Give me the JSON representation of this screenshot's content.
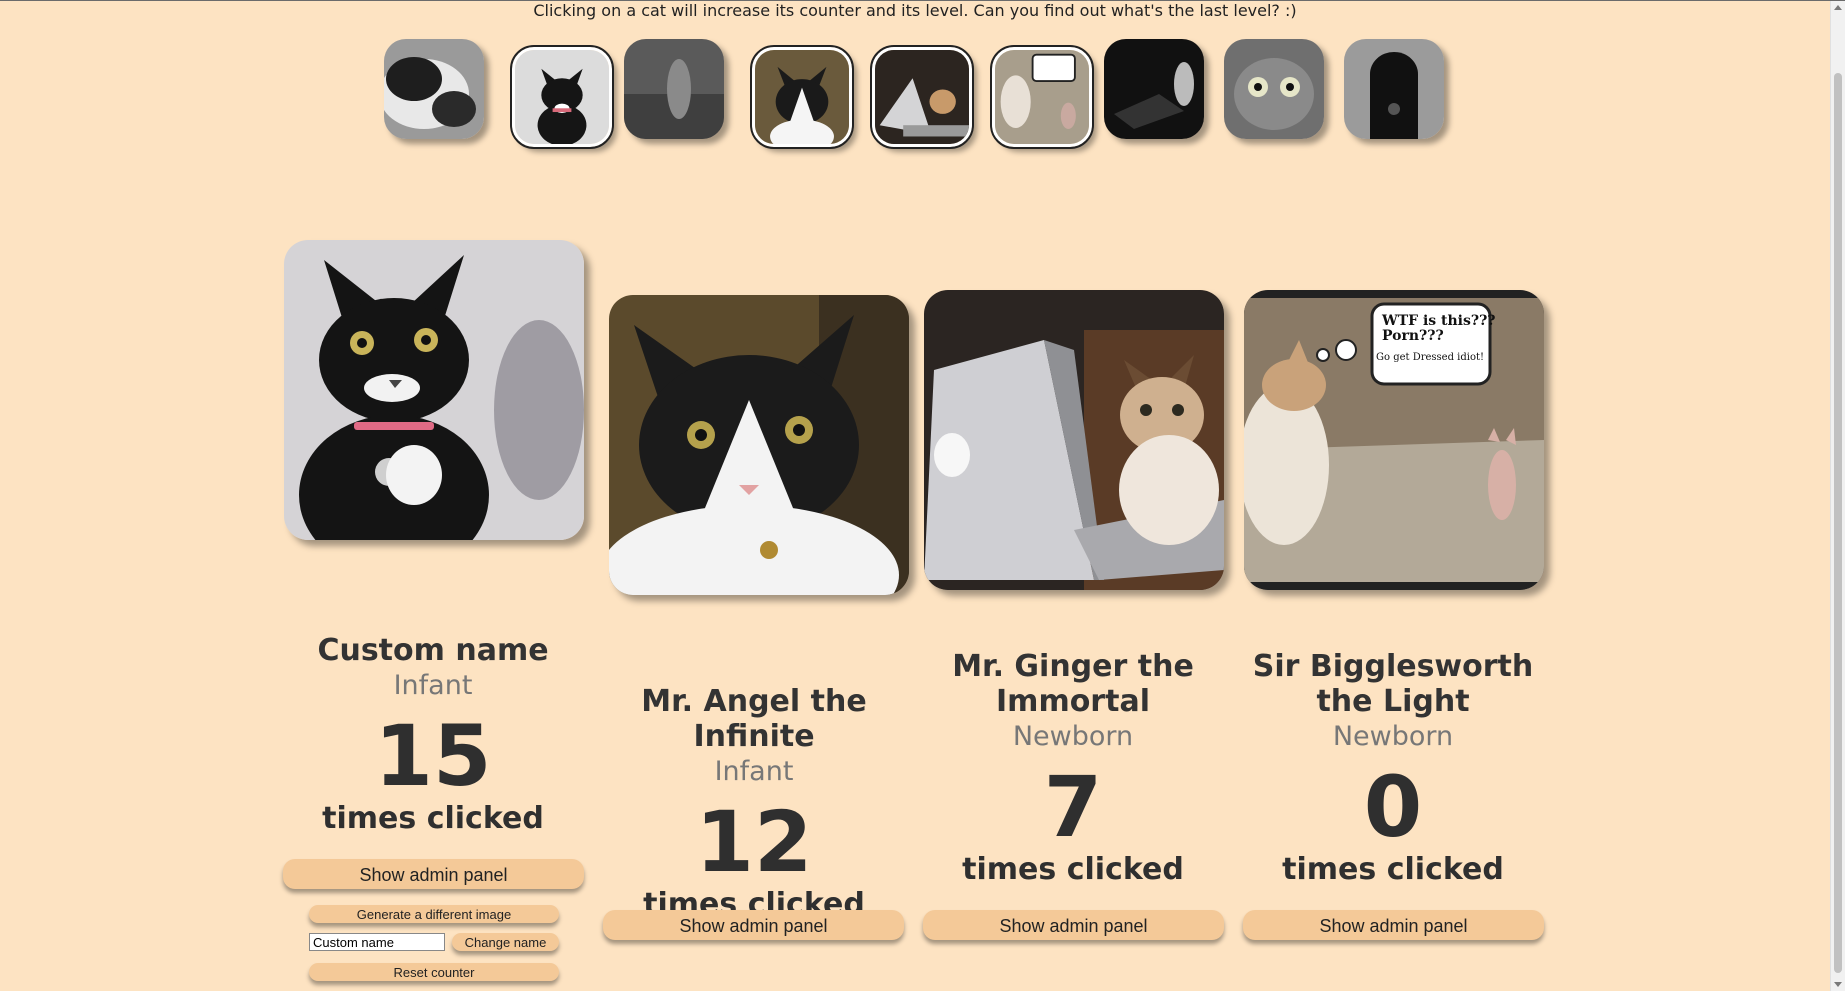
{
  "instructions": "Clicking on a cat will increase its counter and its level. Can you find out what's the last level? :)",
  "thumbnails": [
    {
      "name": "cat-thumb-1",
      "selected": false
    },
    {
      "name": "cat-thumb-2",
      "selected": true
    },
    {
      "name": "cat-thumb-3",
      "selected": false
    },
    {
      "name": "cat-thumb-4",
      "selected": true
    },
    {
      "name": "cat-thumb-5",
      "selected": true
    },
    {
      "name": "cat-thumb-6",
      "selected": true
    },
    {
      "name": "cat-thumb-7",
      "selected": false
    },
    {
      "name": "cat-thumb-8",
      "selected": false
    },
    {
      "name": "cat-thumb-9",
      "selected": false
    }
  ],
  "cats": [
    {
      "name": "Custom name",
      "level": "Infant",
      "count": "15",
      "clicked_label": "times clicked",
      "admin_button": "Show admin panel"
    },
    {
      "name": "Mr. Angel the Infinite",
      "level": "Infant",
      "count": "12",
      "clicked_label": "times clicked",
      "admin_button": "Show admin panel"
    },
    {
      "name": "Mr. Ginger the Immortal",
      "level": "Newborn",
      "count": "7",
      "clicked_label": "times clicked",
      "admin_button": "Show admin panel"
    },
    {
      "name": "Sir Bigglesworth the Light",
      "level": "Newborn",
      "count": "0",
      "clicked_label": "times clicked",
      "admin_button": "Show admin panel"
    }
  ],
  "admin_panel": {
    "generate_label": "Generate a different image",
    "name_input_value": "Custom name",
    "change_name_label": "Change name",
    "reset_label": "Reset counter"
  },
  "speech_bubble": {
    "line1": "WTF is this???",
    "line2": "Porn???",
    "line3": "Go get Dressed idiot!"
  }
}
